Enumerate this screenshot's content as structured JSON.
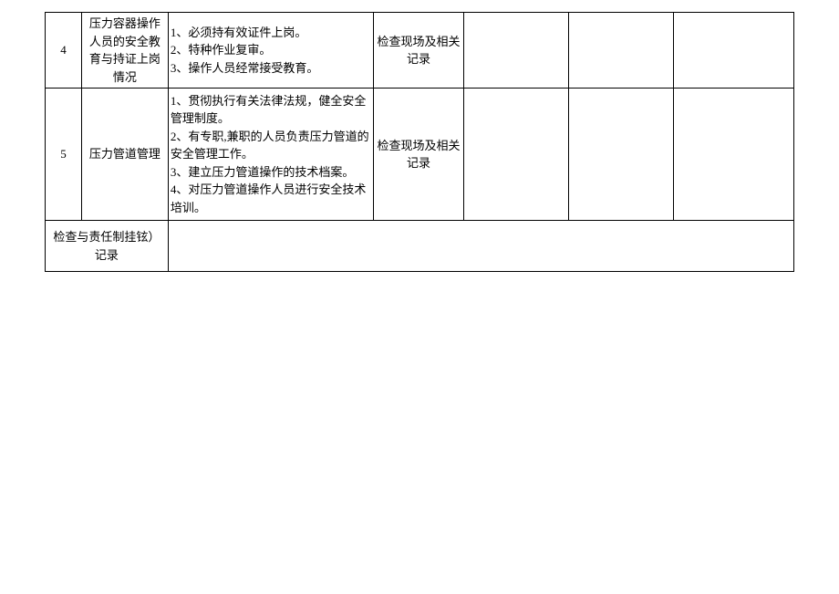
{
  "table": {
    "rows": [
      {
        "num": "4",
        "title": "压力容器操作人员的安全教育与持证上岗情况",
        "content": "1、必须持有效证件上岗。\n2、特种作业复审。\n3、操作人员经常接受教育。",
        "method": "检查现场及相关记录",
        "c5": "",
        "c6": "",
        "c7": ""
      },
      {
        "num": "5",
        "title": "压力管道管理",
        "content": "1、贯彻执行有关法律法规，健全安全管理制度。\n2、有专职,兼职的人员负责压力管道的安全管理工作。\n3、建立压力管道操作的技术档案。\n4、对压力管道操作人员进行安全技术培训。",
        "method": "检查现场及相关记录",
        "c5": "",
        "c6": "",
        "c7": ""
      }
    ],
    "footer": {
      "label": "检查与责任制挂铉）记录",
      "content": ""
    }
  }
}
